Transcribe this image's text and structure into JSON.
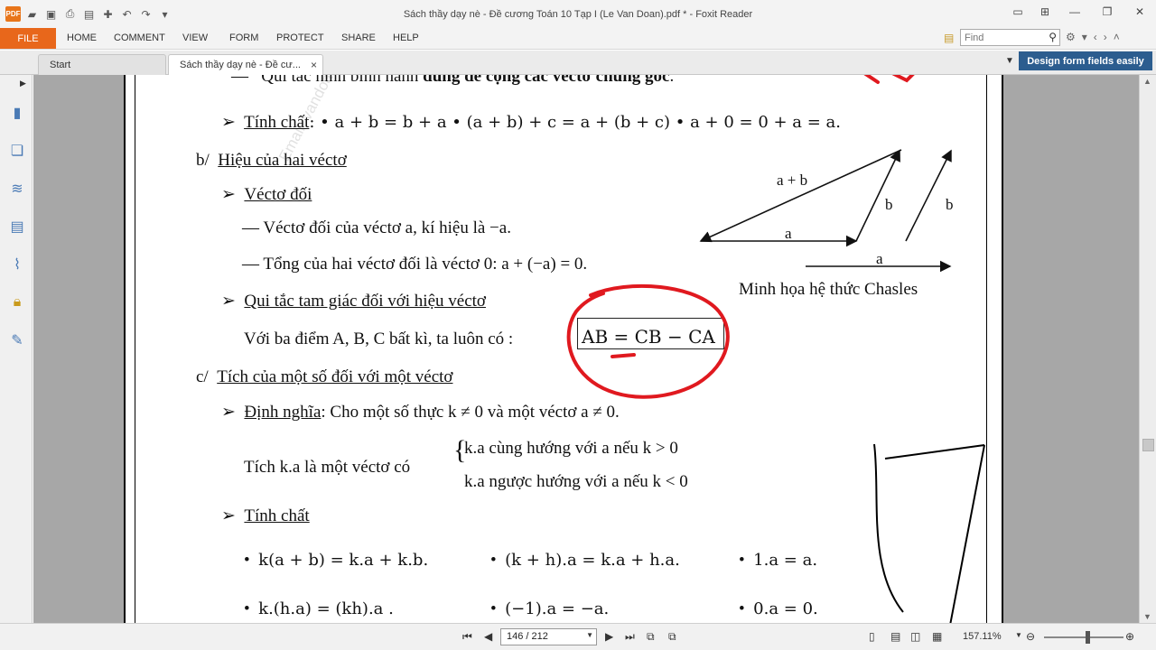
{
  "window": {
    "title": "Sách thầy dạy nè - Đề cương Toán 10 Tạp I (Le Van Doan).pdf * - Foxit Reader",
    "logo_text": "PDF"
  },
  "ribbon": {
    "file_label": "FILE",
    "tabs": [
      "HOME",
      "COMMENT",
      "VIEW",
      "FORM",
      "PROTECT",
      "SHARE",
      "HELP"
    ],
    "find_placeholder": "Find"
  },
  "doc_tabs": {
    "start_label": "Start",
    "doc_label": "Sách thầy dạy nè - Đề cư...",
    "close_glyph": "×",
    "banner": "Design form fields easily"
  },
  "page_content": {
    "l1_dash": "—",
    "l1_text": "Qui tắc hình bình hành ",
    "l1_bold": "dùng để cộng các véctơ chung gốc",
    "l1_end": ".",
    "tinh_chat_1": "Tính chất",
    "tinh_chat_1_formulas": ":  •  a + b = b + a      •  (a + b) + c = a + (b + c)   •  a + 0 = 0 + a = a.",
    "section_b": "b/",
    "section_b_title": "Hiệu của hai véctơ",
    "vecto_doi": "Véctơ đối",
    "line_vecto_doi": "—   Véctơ đối của véctơ a, kí hiệu là  −a.",
    "line_tong": "—   Tổng của hai véctơ đối là véctơ 0:  a + (−a) = 0.",
    "qui_tac": "Qui tắc tam giác đối với hiệu véctơ",
    "line_voi_ba": "Với ba điểm A, B, C bất kì, ta luôn có :",
    "boxed_formula": "AB = CB − CA",
    "section_c": "c/",
    "section_c_title": "Tích của một số đối với một véctơ",
    "dinh_nghia": "Định nghĩa",
    "dinh_nghia_text": ":  Cho một số thực  k ≠ 0  và một véctơ  a ≠ 0.",
    "tich_label": "Tích  k.a  là một véctơ có",
    "case1": "k.a  cùng hướng với  a  nếu  k > 0",
    "case2": "k.a  ngược hướng với  a  nếu  k < 0",
    "tinh_chat_2": "Tính chất",
    "prop_row1": [
      "k(a + b) = k.a + k.b.",
      "(k + h).a = k.a + h.a.",
      "1.a = a."
    ],
    "prop_row2": [
      "k.(h.a) = (kh).a .",
      "(−1).a = −a.",
      "0.a = 0."
    ],
    "bullet": "•",
    "watermark": "Email: vandoan_automobile@yahoo.com"
  },
  "figure": {
    "label_a_plus_b": "a + b",
    "label_a": "a",
    "label_b": "b",
    "label_b2": "b",
    "label_a2": "a",
    "caption": "Minh họa hệ thức Chasles"
  },
  "annotation": {
    "color": "#e0191f"
  },
  "statusbar": {
    "page_value": "146 / 212",
    "zoom_value": "157.11%"
  }
}
